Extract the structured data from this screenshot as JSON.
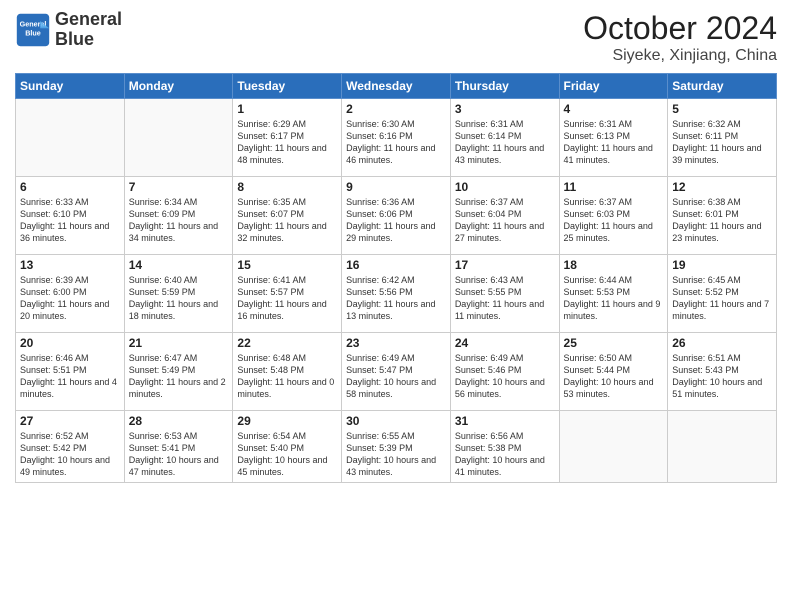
{
  "header": {
    "logo_line1": "General",
    "logo_line2": "Blue",
    "month_year": "October 2024",
    "location": "Siyeke, Xinjiang, China"
  },
  "weekdays": [
    "Sunday",
    "Monday",
    "Tuesday",
    "Wednesday",
    "Thursday",
    "Friday",
    "Saturday"
  ],
  "weeks": [
    [
      {
        "day": "",
        "sunrise": "",
        "sunset": "",
        "daylight": ""
      },
      {
        "day": "",
        "sunrise": "",
        "sunset": "",
        "daylight": ""
      },
      {
        "day": "1",
        "sunrise": "Sunrise: 6:29 AM",
        "sunset": "Sunset: 6:17 PM",
        "daylight": "Daylight: 11 hours and 48 minutes."
      },
      {
        "day": "2",
        "sunrise": "Sunrise: 6:30 AM",
        "sunset": "Sunset: 6:16 PM",
        "daylight": "Daylight: 11 hours and 46 minutes."
      },
      {
        "day": "3",
        "sunrise": "Sunrise: 6:31 AM",
        "sunset": "Sunset: 6:14 PM",
        "daylight": "Daylight: 11 hours and 43 minutes."
      },
      {
        "day": "4",
        "sunrise": "Sunrise: 6:31 AM",
        "sunset": "Sunset: 6:13 PM",
        "daylight": "Daylight: 11 hours and 41 minutes."
      },
      {
        "day": "5",
        "sunrise": "Sunrise: 6:32 AM",
        "sunset": "Sunset: 6:11 PM",
        "daylight": "Daylight: 11 hours and 39 minutes."
      }
    ],
    [
      {
        "day": "6",
        "sunrise": "Sunrise: 6:33 AM",
        "sunset": "Sunset: 6:10 PM",
        "daylight": "Daylight: 11 hours and 36 minutes."
      },
      {
        "day": "7",
        "sunrise": "Sunrise: 6:34 AM",
        "sunset": "Sunset: 6:09 PM",
        "daylight": "Daylight: 11 hours and 34 minutes."
      },
      {
        "day": "8",
        "sunrise": "Sunrise: 6:35 AM",
        "sunset": "Sunset: 6:07 PM",
        "daylight": "Daylight: 11 hours and 32 minutes."
      },
      {
        "day": "9",
        "sunrise": "Sunrise: 6:36 AM",
        "sunset": "Sunset: 6:06 PM",
        "daylight": "Daylight: 11 hours and 29 minutes."
      },
      {
        "day": "10",
        "sunrise": "Sunrise: 6:37 AM",
        "sunset": "Sunset: 6:04 PM",
        "daylight": "Daylight: 11 hours and 27 minutes."
      },
      {
        "day": "11",
        "sunrise": "Sunrise: 6:37 AM",
        "sunset": "Sunset: 6:03 PM",
        "daylight": "Daylight: 11 hours and 25 minutes."
      },
      {
        "day": "12",
        "sunrise": "Sunrise: 6:38 AM",
        "sunset": "Sunset: 6:01 PM",
        "daylight": "Daylight: 11 hours and 23 minutes."
      }
    ],
    [
      {
        "day": "13",
        "sunrise": "Sunrise: 6:39 AM",
        "sunset": "Sunset: 6:00 PM",
        "daylight": "Daylight: 11 hours and 20 minutes."
      },
      {
        "day": "14",
        "sunrise": "Sunrise: 6:40 AM",
        "sunset": "Sunset: 5:59 PM",
        "daylight": "Daylight: 11 hours and 18 minutes."
      },
      {
        "day": "15",
        "sunrise": "Sunrise: 6:41 AM",
        "sunset": "Sunset: 5:57 PM",
        "daylight": "Daylight: 11 hours and 16 minutes."
      },
      {
        "day": "16",
        "sunrise": "Sunrise: 6:42 AM",
        "sunset": "Sunset: 5:56 PM",
        "daylight": "Daylight: 11 hours and 13 minutes."
      },
      {
        "day": "17",
        "sunrise": "Sunrise: 6:43 AM",
        "sunset": "Sunset: 5:55 PM",
        "daylight": "Daylight: 11 hours and 11 minutes."
      },
      {
        "day": "18",
        "sunrise": "Sunrise: 6:44 AM",
        "sunset": "Sunset: 5:53 PM",
        "daylight": "Daylight: 11 hours and 9 minutes."
      },
      {
        "day": "19",
        "sunrise": "Sunrise: 6:45 AM",
        "sunset": "Sunset: 5:52 PM",
        "daylight": "Daylight: 11 hours and 7 minutes."
      }
    ],
    [
      {
        "day": "20",
        "sunrise": "Sunrise: 6:46 AM",
        "sunset": "Sunset: 5:51 PM",
        "daylight": "Daylight: 11 hours and 4 minutes."
      },
      {
        "day": "21",
        "sunrise": "Sunrise: 6:47 AM",
        "sunset": "Sunset: 5:49 PM",
        "daylight": "Daylight: 11 hours and 2 minutes."
      },
      {
        "day": "22",
        "sunrise": "Sunrise: 6:48 AM",
        "sunset": "Sunset: 5:48 PM",
        "daylight": "Daylight: 11 hours and 0 minutes."
      },
      {
        "day": "23",
        "sunrise": "Sunrise: 6:49 AM",
        "sunset": "Sunset: 5:47 PM",
        "daylight": "Daylight: 10 hours and 58 minutes."
      },
      {
        "day": "24",
        "sunrise": "Sunrise: 6:49 AM",
        "sunset": "Sunset: 5:46 PM",
        "daylight": "Daylight: 10 hours and 56 minutes."
      },
      {
        "day": "25",
        "sunrise": "Sunrise: 6:50 AM",
        "sunset": "Sunset: 5:44 PM",
        "daylight": "Daylight: 10 hours and 53 minutes."
      },
      {
        "day": "26",
        "sunrise": "Sunrise: 6:51 AM",
        "sunset": "Sunset: 5:43 PM",
        "daylight": "Daylight: 10 hours and 51 minutes."
      }
    ],
    [
      {
        "day": "27",
        "sunrise": "Sunrise: 6:52 AM",
        "sunset": "Sunset: 5:42 PM",
        "daylight": "Daylight: 10 hours and 49 minutes."
      },
      {
        "day": "28",
        "sunrise": "Sunrise: 6:53 AM",
        "sunset": "Sunset: 5:41 PM",
        "daylight": "Daylight: 10 hours and 47 minutes."
      },
      {
        "day": "29",
        "sunrise": "Sunrise: 6:54 AM",
        "sunset": "Sunset: 5:40 PM",
        "daylight": "Daylight: 10 hours and 45 minutes."
      },
      {
        "day": "30",
        "sunrise": "Sunrise: 6:55 AM",
        "sunset": "Sunset: 5:39 PM",
        "daylight": "Daylight: 10 hours and 43 minutes."
      },
      {
        "day": "31",
        "sunrise": "Sunrise: 6:56 AM",
        "sunset": "Sunset: 5:38 PM",
        "daylight": "Daylight: 10 hours and 41 minutes."
      },
      {
        "day": "",
        "sunrise": "",
        "sunset": "",
        "daylight": ""
      },
      {
        "day": "",
        "sunrise": "",
        "sunset": "",
        "daylight": ""
      }
    ]
  ]
}
